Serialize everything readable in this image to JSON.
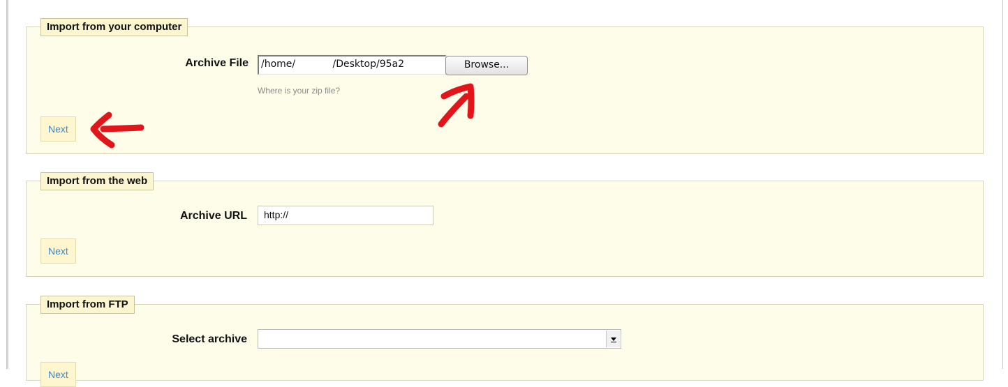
{
  "sections": {
    "computer": {
      "legend": "Import from your computer",
      "field_label": "Archive File",
      "file_value": "/home/            /Desktop/95a2",
      "browse_label": "Browse...",
      "hint": "Where is your zip file?",
      "next_label": "Next"
    },
    "web": {
      "legend": "Import from the web",
      "field_label": "Archive URL",
      "url_value": "http://",
      "next_label": "Next"
    },
    "ftp": {
      "legend": "Import from FTP",
      "field_label": "Select archive",
      "selected_value": "",
      "next_label": "Next"
    }
  },
  "annotations": {
    "color": "#e0161b"
  },
  "colors": {
    "panel_bg": "#fdfdea",
    "legend_bg": "#fbf6cf",
    "link_blue": "#3d87c9"
  }
}
